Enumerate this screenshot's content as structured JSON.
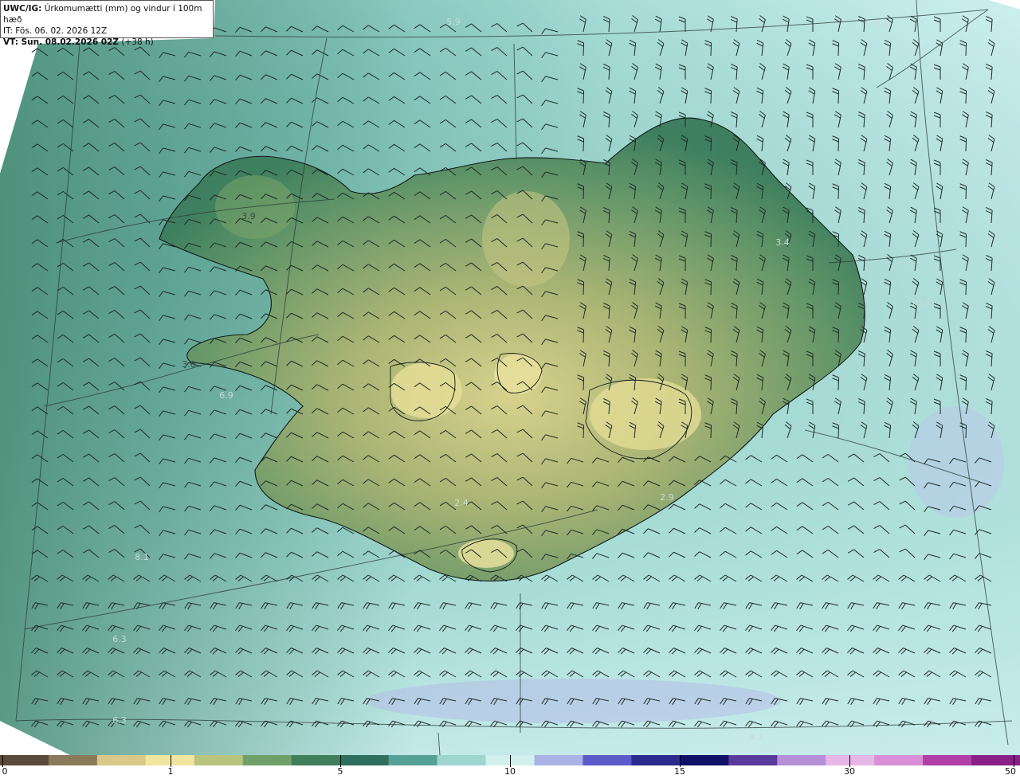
{
  "title": {
    "product": "UWC/IG:",
    "description": "Úrkomumætti (mm) og vindur í 100m hæð",
    "issue_time": "IT: Fös. 06. 02. 2026 12Z",
    "valid_label": "VT: Sun. 08.02.2026 02Z",
    "lead": "(+38 h)"
  },
  "value_labels": [
    {
      "text": "5.9",
      "kind": "light"
    },
    {
      "text": "9.9",
      "kind": "light"
    },
    {
      "text": "3.9",
      "kind": "strong"
    },
    {
      "text": "3.4",
      "kind": "light"
    },
    {
      "text": "10.3",
      "kind": "light"
    },
    {
      "text": "3.6",
      "kind": "strong"
    },
    {
      "text": "6.9",
      "kind": "light"
    },
    {
      "text": "2.4",
      "kind": "light"
    },
    {
      "text": "2.9",
      "kind": "light"
    },
    {
      "text": "8.1",
      "kind": "light"
    },
    {
      "text": "6.3",
      "kind": "light"
    },
    {
      "text": "6.3",
      "kind": "light"
    },
    {
      "text": "9.7",
      "kind": "light"
    }
  ],
  "colorbar": {
    "ticks": [
      "0",
      "1",
      "5",
      "10",
      "15",
      "30",
      "50"
    ],
    "colors": [
      "#5a4a3c",
      "#8a7a5a",
      "#d8c98a",
      "#f1e6a0",
      "#b9c47e",
      "#6fa06a",
      "#3f7f5c",
      "#2f6f5e",
      "#56a196",
      "#9fd6cf",
      "#d2f1ee",
      "#a9b3e6",
      "#5a5ac9",
      "#2a2a8f",
      "#101066",
      "#5a3a9a",
      "#b58fd8",
      "#e7b6e8",
      "#d98fd8",
      "#b03fa8",
      "#8a1f88"
    ]
  },
  "colors": {
    "ocean_north": "#6fb6ad",
    "ocean_east": "#b9e7e4",
    "ocean_south": "#5aa596",
    "land_low": "#3d7e5e",
    "land_mid": "#9cad6c",
    "land_high": "#d9d58e",
    "graticule": "#2b3b37",
    "coast": "#101a16",
    "barb": "#1f2a27"
  }
}
